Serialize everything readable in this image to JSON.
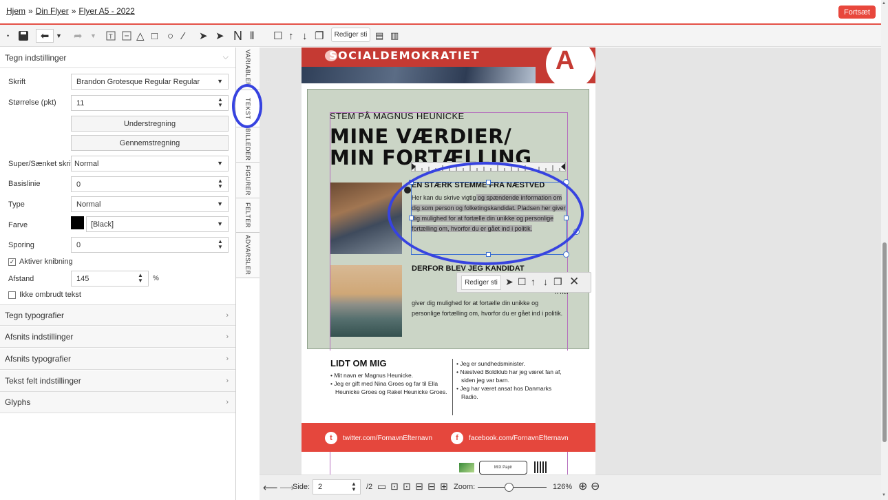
{
  "breadcrumb": {
    "items": [
      "Hjem",
      "Din Flyer",
      "Flyer A5 - 2022"
    ],
    "separator": "»"
  },
  "header": {
    "continue_label": "Fortsæt"
  },
  "toolbar": {
    "edit_path_label": "Rediger sti"
  },
  "panel": {
    "section_title": "Tegn indstillinger",
    "font_label": "Skrift",
    "font_value": "Brandon Grotesque Regular Regular",
    "size_label": "Størrelse (pkt)",
    "size_value": "11",
    "underline_label": "Understregning",
    "strikethrough_label": "Gennemstregning",
    "superscript_label": "Super/Sænket skrift",
    "superscript_value": "Normal",
    "baseline_label": "Basislinie",
    "baseline_value": "0",
    "type_label": "Type",
    "type_value": "Normal",
    "color_label": "Farve",
    "color_value": "[Black]",
    "color_swatch": "#000000",
    "tracking_label": "Sporing",
    "tracking_value": "0",
    "kerning_label": "Aktiver knibning",
    "kerning_checked": true,
    "spacing_label": "Afstand",
    "spacing_value": "145",
    "spacing_unit": "%",
    "nowrap_label": "Ikke ombrudt tekst",
    "nowrap_checked": false,
    "collapsed_sections": [
      "Tegn typografier",
      "Afsnits indstillinger",
      "Afsnits typografier",
      "Tekst felt indstillinger",
      "Glyphs"
    ]
  },
  "vtabs": [
    "VARIABLER",
    "TEKST",
    "BILLEDER",
    "FIGURER",
    "FELTER",
    "ADVARSLER"
  ],
  "document": {
    "party_name": "SOCIALDEMOKRATIET",
    "party_letter": "A",
    "kicker": "STEM PÅ MAGNUS HEUNICKE",
    "headline_1": "MINE VÆRDIER/",
    "headline_2": "MIN FORTÆLLING",
    "sub1": "EN STÆRK STEMME FRA NÆSTVED",
    "body1_a": "Her kan du skrive vigtig",
    "body1_b": " og spændende information om dig som person og folketingskandidat. Pladsen her giver dig mulighed for at fortælle din unikke og personlige fortælling om, hvorfor du er gået ind i politik.",
    "sub2": "DERFOR BLEV JEG KANDIDAT",
    "body2_tail_1": "n",
    "body2_tail_2": "n her",
    "body2": "giver dig mulighed for at fortælle din unikke og personlige fortælling om, hvorfor du er gået ind i politik.",
    "about_title": "LIDT OM MIG",
    "about_left": [
      "Mit navn er Magnus Heunicke.",
      "Jeg er gift med Nina Groes og far til Ella Heunicke Groes og Rakel Heunicke Groes."
    ],
    "about_right": [
      "Jeg er sundhedsminister.",
      "Næstved Boldklub har jeg været fan af, siden jeg var barn.",
      "Jeg har været ansat hos Danmarks Radio."
    ],
    "twitter": "twitter.com/FornavnEfternavn",
    "facebook": "facebook.com/FornavnEfternavn",
    "logo_mix": "MIX Papir"
  },
  "float_toolbar": {
    "edit_path_label": "Rediger sti"
  },
  "bottombar": {
    "page_label": "Side:",
    "page_value": "2",
    "page_total": "/2",
    "zoom_label": "Zoom:",
    "zoom_value": "126%",
    "zoom_fraction": 0.45
  },
  "colors": {
    "accent": "#e8473c",
    "party_red": "#c53a33",
    "sage": "#cbd5c6",
    "annotation": "#3743e0"
  }
}
